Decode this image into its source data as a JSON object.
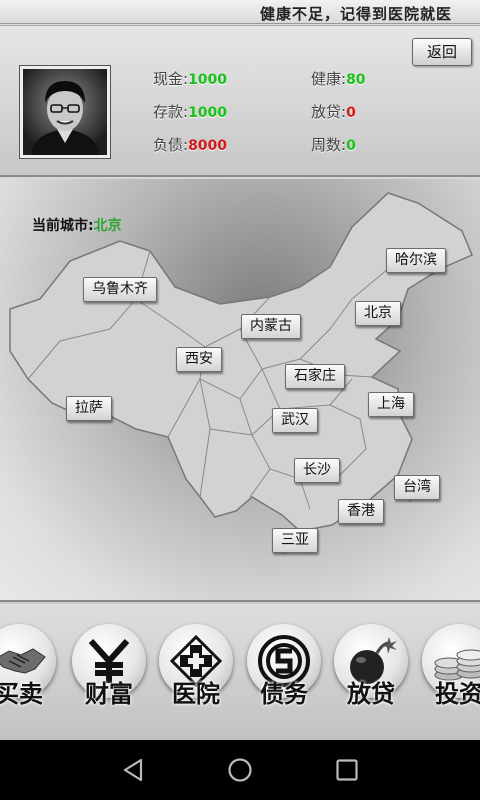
{
  "status": {
    "message": "健康不足，记得到医院就医"
  },
  "header": {
    "back_label": "返回"
  },
  "player": {
    "cash_label": "现金:",
    "cash_value": "1000",
    "health_label": "健康:",
    "health_value": "80",
    "deposit_label": "存款:",
    "deposit_value": "1000",
    "loan_label": "放贷:",
    "loan_value": "0",
    "debt_label": "负债:",
    "debt_value": "8000",
    "weeks_label": "周数:",
    "weeks_value": "0"
  },
  "map": {
    "current_city_label": "当前城市:",
    "current_city_value": "北京",
    "cities": [
      "哈尔滨",
      "乌鲁木齐",
      "北京",
      "内蒙古",
      "西安",
      "石家庄",
      "上海",
      "拉萨",
      "武汉",
      "长沙",
      "台湾",
      "香港",
      "三亚"
    ]
  },
  "actions": [
    {
      "label": "买卖",
      "icon": "handshake-icon"
    },
    {
      "label": "财富",
      "icon": "wealth-icon"
    },
    {
      "label": "医院",
      "icon": "hospital-cross-icon"
    },
    {
      "label": "债务",
      "icon": "debt-coin-icon"
    },
    {
      "label": "放贷",
      "icon": "bomb-icon"
    },
    {
      "label": "投资",
      "icon": "coin-stack-icon"
    }
  ],
  "colors": {
    "positive": "#17c317",
    "negative": "#d21b1b",
    "current_city": "#2fa52f"
  }
}
